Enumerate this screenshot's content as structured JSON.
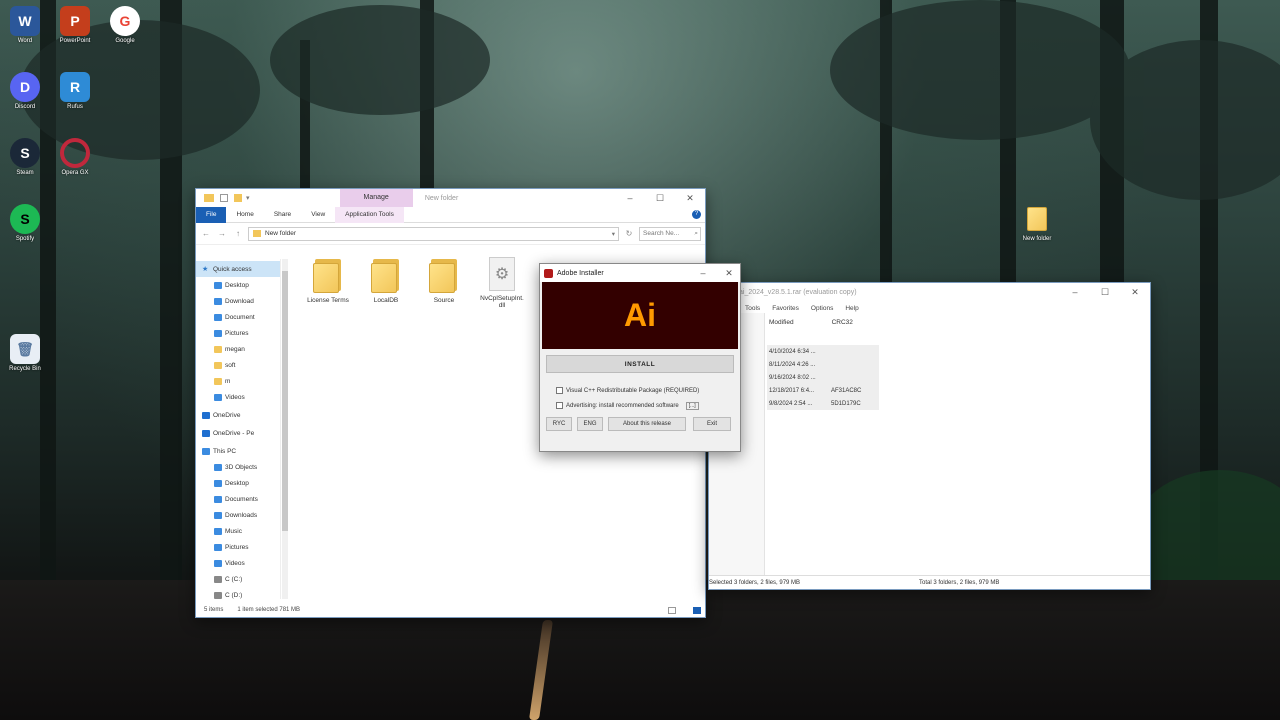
{
  "desktop": {
    "icons": [
      {
        "label": "Word",
        "color": "#2b579a",
        "glyph": "W"
      },
      {
        "label": "PowerPoint",
        "color": "#c43e1c",
        "glyph": "P"
      },
      {
        "label": "Google",
        "color": "#ffffff",
        "glyph": "G"
      },
      {
        "label": "Discord",
        "color": "#5865f2",
        "glyph": "D"
      },
      {
        "label": "Rufus",
        "color": "#2e8bd6",
        "glyph": "R"
      },
      {
        "label": "Steam",
        "color": "#1b2838",
        "glyph": "S"
      },
      {
        "label": "Opera GX",
        "color": "#7a1020",
        "glyph": "O"
      },
      {
        "label": "Spotify",
        "color": "#1db954",
        "glyph": "S"
      },
      {
        "label": "Recycle Bin",
        "color": "#8fa7c2",
        "glyph": "🗑"
      },
      {
        "label": "New folder",
        "color": "#f2c65a",
        "glyph": ""
      }
    ]
  },
  "explorer": {
    "title": "New folder",
    "contextual_tab": "Manage",
    "tabs": [
      "File",
      "Home",
      "Share",
      "View",
      "Application Tools"
    ],
    "address": "New folder",
    "search_placeholder": "Search Ne...",
    "nav": [
      {
        "label": "Quick access",
        "type": "star",
        "selected": true
      },
      {
        "label": "Desktop",
        "type": "blue"
      },
      {
        "label": "Download",
        "type": "blue"
      },
      {
        "label": "Document",
        "type": "blue"
      },
      {
        "label": "Pictures",
        "type": "blue"
      },
      {
        "label": "megan",
        "type": "folder"
      },
      {
        "label": "soft",
        "type": "folder"
      },
      {
        "label": "m",
        "type": "folder"
      },
      {
        "label": "Videos",
        "type": "blue"
      },
      {
        "label": "OneDrive",
        "type": "cloud"
      },
      {
        "label": "OneDrive - Pe",
        "type": "cloud"
      },
      {
        "label": "This PC",
        "type": "pc"
      },
      {
        "label": "3D Objects",
        "type": "blue"
      },
      {
        "label": "Desktop",
        "type": "blue"
      },
      {
        "label": "Documents",
        "type": "blue"
      },
      {
        "label": "Downloads",
        "type": "blue"
      },
      {
        "label": "Music",
        "type": "blue"
      },
      {
        "label": "Pictures",
        "type": "blue"
      },
      {
        "label": "Videos",
        "type": "blue"
      },
      {
        "label": "C (C:)",
        "type": "drive"
      },
      {
        "label": "C (D:)",
        "type": "drive"
      }
    ],
    "files": [
      {
        "name": "License Terms",
        "type": "folder"
      },
      {
        "name": "LocalDB",
        "type": "folder"
      },
      {
        "name": "Source",
        "type": "folder"
      },
      {
        "name": "NvCplSetupInt.dll",
        "type": "dll"
      }
    ],
    "status": {
      "items": "5 items",
      "selected": "1 item selected  781 MB"
    }
  },
  "winrar": {
    "title": "ai_2024_v28.5.1.rar (evaluation copy)",
    "menu": [
      "Tools",
      "Favorites",
      "Options",
      "Help"
    ],
    "columns": [
      "Modified",
      "CRC32"
    ],
    "rows": [
      {
        "modified": "4/10/2024 6:34 ...",
        "crc": ""
      },
      {
        "modified": "8/11/2024 4:26 ...",
        "crc": ""
      },
      {
        "modified": "9/16/2024 8:02 ...",
        "crc": ""
      },
      {
        "modified": "12/18/2017 6:4...",
        "crc": "AF31AC8C"
      },
      {
        "modified": "9/8/2024 2:54 ...",
        "crc": "5D1D179C"
      }
    ],
    "status_left": "Selected 3 folders, 2 files, 979 MB",
    "status_right": "Total 3 folders, 2 files, 979 MB"
  },
  "installer": {
    "title": "Adobe Installer",
    "logo": "Ai",
    "install_label": "INSTALL",
    "check1": "Visual C++ Redistributable Package (REQUIRED)",
    "check2": "Advertising: install recommended software",
    "check2_more": "[...]",
    "buttons": {
      "ryc": "RYC",
      "eng": "ENG",
      "about": "About this release",
      "exit": "Exit"
    }
  },
  "colors": {
    "accent": "#1a5fb4",
    "banner": "#330000",
    "ai_orange": "#ff9a00"
  }
}
